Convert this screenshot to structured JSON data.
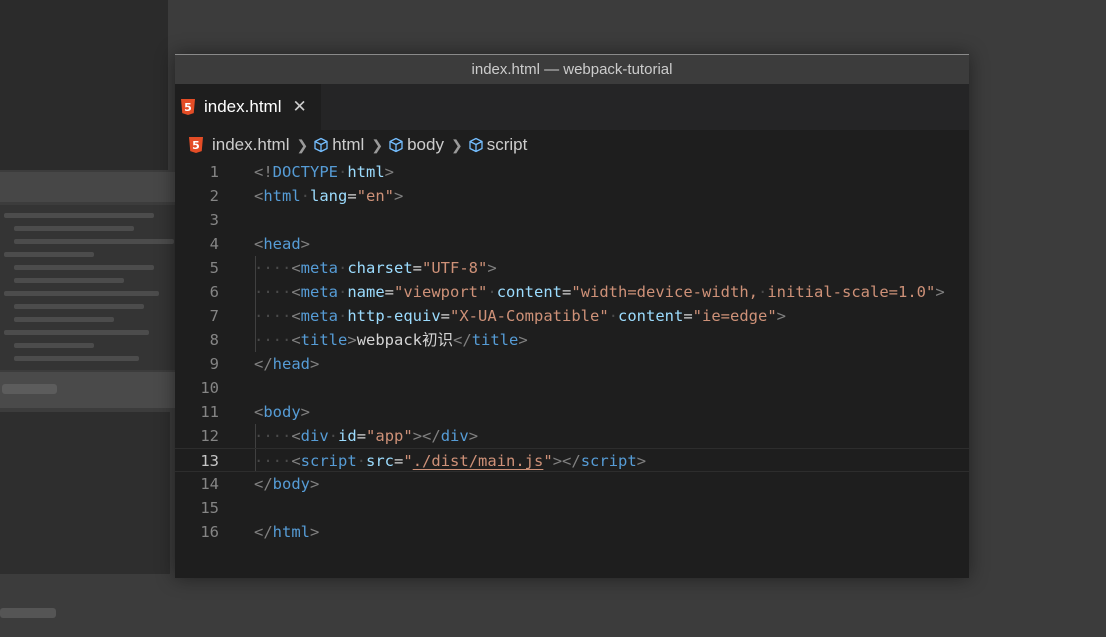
{
  "window": {
    "title": "index.html — webpack-tutorial"
  },
  "tab": {
    "label": "index.html",
    "icon": "html5-icon",
    "close_glyph": "✕"
  },
  "breadcrumb": {
    "file": "index.html",
    "items": [
      "html",
      "body",
      "script"
    ]
  },
  "colors": {
    "tag": "#569cd6",
    "attribute": "#9cdcfe",
    "string": "#ce9178",
    "punctuation": "#808080",
    "html5_icon": "#e44d26"
  },
  "editor": {
    "current_line": 13,
    "lines": [
      {
        "n": "1",
        "tokens": [
          [
            "punc",
            "<!"
          ],
          [
            "tag",
            "DOCTYPE"
          ],
          [
            "ws",
            "·"
          ],
          [
            "attr",
            "html"
          ],
          [
            "punc",
            ">"
          ]
        ]
      },
      {
        "n": "2",
        "tokens": [
          [
            "punc",
            "<"
          ],
          [
            "tag",
            "html"
          ],
          [
            "ws",
            "·"
          ],
          [
            "attr",
            "lang"
          ],
          [
            "text",
            "="
          ],
          [
            "str",
            "\"en\""
          ],
          [
            "punc",
            ">"
          ]
        ]
      },
      {
        "n": "3",
        "tokens": []
      },
      {
        "n": "4",
        "tokens": [
          [
            "punc",
            "<"
          ],
          [
            "tag",
            "head"
          ],
          [
            "punc",
            ">"
          ]
        ]
      },
      {
        "n": "5",
        "tokens": [
          [
            "ws",
            "····"
          ],
          [
            "punc",
            "<"
          ],
          [
            "tag",
            "meta"
          ],
          [
            "ws",
            "·"
          ],
          [
            "attr",
            "charset"
          ],
          [
            "text",
            "="
          ],
          [
            "str",
            "\"UTF-8\""
          ],
          [
            "punc",
            ">"
          ]
        ]
      },
      {
        "n": "6",
        "tokens": [
          [
            "ws",
            "····"
          ],
          [
            "punc",
            "<"
          ],
          [
            "tag",
            "meta"
          ],
          [
            "ws",
            "·"
          ],
          [
            "attr",
            "name"
          ],
          [
            "text",
            "="
          ],
          [
            "str",
            "\"viewport\""
          ],
          [
            "ws",
            "·"
          ],
          [
            "attr",
            "content"
          ],
          [
            "text",
            "="
          ],
          [
            "str",
            "\"width=device-width,"
          ],
          [
            "ws",
            "·"
          ],
          [
            "str",
            "initial-scale=1.0\""
          ],
          [
            "punc",
            ">"
          ]
        ]
      },
      {
        "n": "7",
        "tokens": [
          [
            "ws",
            "····"
          ],
          [
            "punc",
            "<"
          ],
          [
            "tag",
            "meta"
          ],
          [
            "ws",
            "·"
          ],
          [
            "attr",
            "http-equiv"
          ],
          [
            "text",
            "="
          ],
          [
            "str",
            "\"X-UA-Compatible\""
          ],
          [
            "ws",
            "·"
          ],
          [
            "attr",
            "content"
          ],
          [
            "text",
            "="
          ],
          [
            "str",
            "\"ie=edge\""
          ],
          [
            "punc",
            ">"
          ]
        ]
      },
      {
        "n": "8",
        "tokens": [
          [
            "ws",
            "····"
          ],
          [
            "punc",
            "<"
          ],
          [
            "tag",
            "title"
          ],
          [
            "punc",
            ">"
          ],
          [
            "text",
            "webpack初识"
          ],
          [
            "punc",
            "</"
          ],
          [
            "tag",
            "title"
          ],
          [
            "punc",
            ">"
          ]
        ]
      },
      {
        "n": "9",
        "tokens": [
          [
            "punc",
            "</"
          ],
          [
            "tag",
            "head"
          ],
          [
            "punc",
            ">"
          ]
        ]
      },
      {
        "n": "10",
        "tokens": []
      },
      {
        "n": "11",
        "tokens": [
          [
            "punc",
            "<"
          ],
          [
            "tag",
            "body"
          ],
          [
            "punc",
            ">"
          ]
        ]
      },
      {
        "n": "12",
        "tokens": [
          [
            "ws",
            "····"
          ],
          [
            "punc",
            "<"
          ],
          [
            "tag",
            "div"
          ],
          [
            "ws",
            "·"
          ],
          [
            "attr",
            "id"
          ],
          [
            "text",
            "="
          ],
          [
            "str",
            "\"app\""
          ],
          [
            "punc",
            "></"
          ],
          [
            "tag",
            "div"
          ],
          [
            "punc",
            ">"
          ]
        ]
      },
      {
        "n": "13",
        "tokens": [
          [
            "ws",
            "····"
          ],
          [
            "punc",
            "<"
          ],
          [
            "tag",
            "script"
          ],
          [
            "ws",
            "·"
          ],
          [
            "attr",
            "src"
          ],
          [
            "text",
            "="
          ],
          [
            "str",
            "\""
          ],
          [
            "link",
            "./dist/main.js"
          ],
          [
            "str",
            "\""
          ],
          [
            "punc",
            "></"
          ],
          [
            "tag",
            "script"
          ],
          [
            "punc",
            ">"
          ]
        ]
      },
      {
        "n": "14",
        "tokens": [
          [
            "punc",
            "</"
          ],
          [
            "tag",
            "body"
          ],
          [
            "punc",
            ">"
          ]
        ]
      },
      {
        "n": "15",
        "tokens": []
      },
      {
        "n": "16",
        "tokens": [
          [
            "punc",
            "</"
          ],
          [
            "tag",
            "html"
          ],
          [
            "punc",
            ">"
          ]
        ]
      }
    ]
  }
}
